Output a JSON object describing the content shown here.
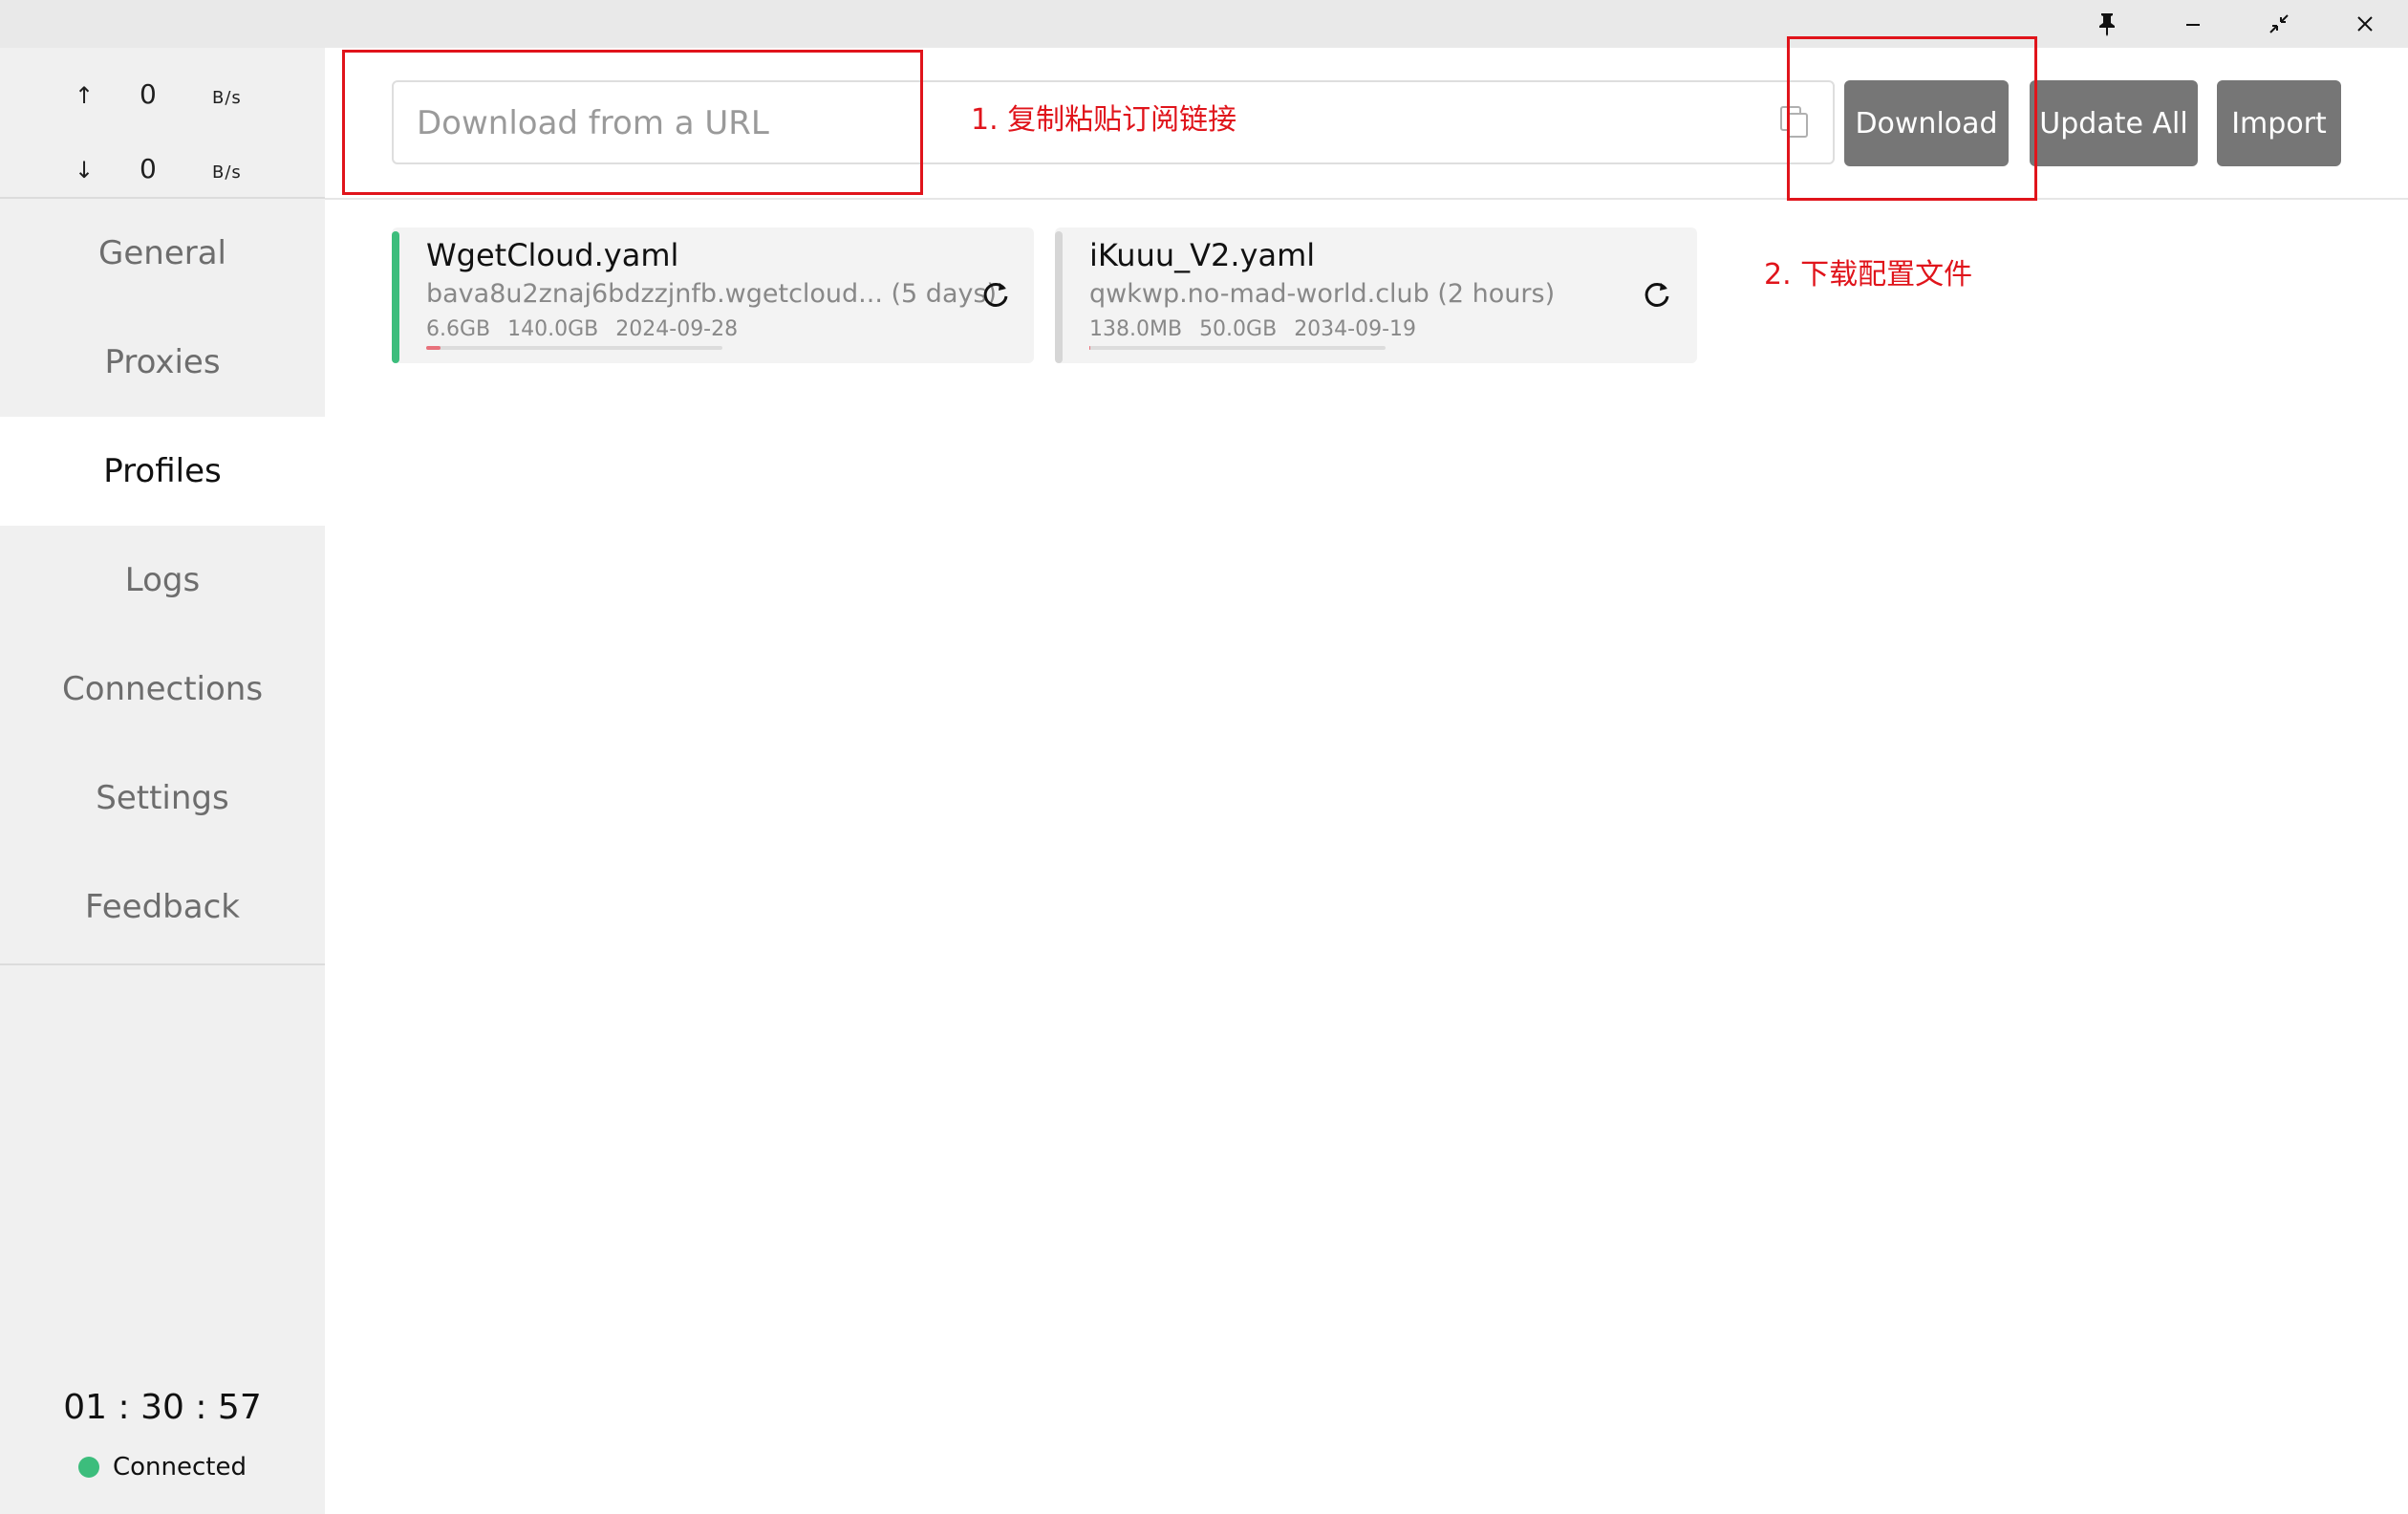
{
  "window": {
    "controls": [
      "pin-icon",
      "minimize-icon",
      "restore-icon",
      "close-icon"
    ]
  },
  "traffic": {
    "up": {
      "arrow": "↑",
      "value": "0",
      "unit": "B/s"
    },
    "down": {
      "arrow": "↓",
      "value": "0",
      "unit": "B/s"
    }
  },
  "nav": {
    "items": [
      "General",
      "Proxies",
      "Profiles",
      "Logs",
      "Connections",
      "Settings",
      "Feedback"
    ],
    "active": "Profiles"
  },
  "status": {
    "uptime": "01 : 30 : 57",
    "connection": "Connected",
    "connection_color": "#3cbd7c"
  },
  "toolbar": {
    "url_placeholder": "Download from a URL",
    "download_label": "Download",
    "update_all_label": "Update All",
    "import_label": "Import"
  },
  "annotations": {
    "step1": "1. 复制粘贴订阅链接",
    "step2": "2. 下载配置文件",
    "color": "#e0141b"
  },
  "profiles": [
    {
      "name": "WgetCloud.yaml",
      "source": "bava8u2znaj6bdzzjnfb.wgetcloud...  (5 days)",
      "used": "6.6GB",
      "total": "140.0GB",
      "expire": "2024-09-28",
      "usage_fraction": 0.047,
      "selected": true,
      "accent": "#3cbd7c"
    },
    {
      "name": "iKuuu_V2.yaml",
      "source": "qwkwp.no-mad-world.club (2 hours)",
      "used": "138.0MB",
      "total": "50.0GB",
      "expire": "2034-09-19",
      "usage_fraction": 0.003,
      "selected": false,
      "accent": "#d6d6d6"
    }
  ]
}
